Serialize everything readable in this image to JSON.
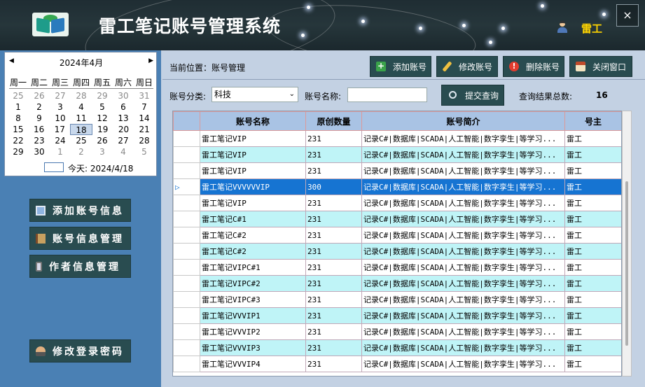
{
  "app": {
    "title": "雷工笔记账号管理系统",
    "user": "雷工",
    "close_icon_glyph": "×"
  },
  "calendar": {
    "month_label": "2024年4月",
    "prev_glyph": "◀",
    "next_glyph": "▶",
    "weekdays": [
      "周一",
      "周二",
      "周三",
      "周四",
      "周五",
      "周六",
      "周日"
    ],
    "weeks": [
      [
        "25",
        "26",
        "27",
        "28",
        "29",
        "30",
        "31"
      ],
      [
        "1",
        "2",
        "3",
        "4",
        "5",
        "6",
        "7"
      ],
      [
        "8",
        "9",
        "10",
        "11",
        "12",
        "13",
        "14"
      ],
      [
        "15",
        "16",
        "17",
        "18",
        "19",
        "20",
        "21"
      ],
      [
        "22",
        "23",
        "24",
        "25",
        "26",
        "27",
        "28"
      ],
      [
        "29",
        "30",
        "1",
        "2",
        "3",
        "4",
        "5"
      ]
    ],
    "selected_day": "18",
    "today_label": "今天: 2024/4/18"
  },
  "sidebar": {
    "items": [
      {
        "label": "添加账号信息",
        "icon": "monitor-icon"
      },
      {
        "label": "账号信息管理",
        "icon": "book-icon"
      },
      {
        "label": "作者信息管理",
        "icon": "phone-icon"
      },
      {
        "label": "修改登录密码",
        "icon": "user-lock-icon"
      }
    ]
  },
  "toolbar": {
    "breadcrumb": "当前位置：账号管理",
    "add_label": "添加账号",
    "edit_label": "修改账号",
    "delete_label": "删除账号",
    "close_label": "关闭窗口"
  },
  "filter": {
    "category_label": "账号分类:",
    "category_value": "科技",
    "name_label": "账号名称:",
    "name_value": "",
    "query_label": "提交查询",
    "total_label": "查询结果总数:",
    "total_value": "16"
  },
  "grid": {
    "columns": [
      "账号名称",
      "原创数量",
      "账号简介",
      "号主"
    ],
    "rows": [
      [
        "雷工笔记VIP",
        "231",
        "记录C#|数据库|SCADA|人工智能|数字孪生|等学习...",
        "雷工"
      ],
      [
        "雷工笔记VIP",
        "231",
        "记录C#|数据库|SCADA|人工智能|数字孪生|等学习...",
        "雷工"
      ],
      [
        "雷工笔记VIP",
        "231",
        "记录C#|数据库|SCADA|人工智能|数字孪生|等学习...",
        "雷工"
      ],
      [
        "雷工笔记VVVVVVIP",
        "300",
        "记录C#|数据库|SCADA|人工智能|数字孪生|等学习...",
        "雷工"
      ],
      [
        "雷工笔记VIP",
        "231",
        "记录C#|数据库|SCADA|人工智能|数字孪生|等学习...",
        "雷工"
      ],
      [
        "雷工笔记C#1",
        "231",
        "记录C#|数据库|SCADA|人工智能|数字孪生|等学习...",
        "雷工"
      ],
      [
        "雷工笔记C#2",
        "231",
        "记录C#|数据库|SCADA|人工智能|数字孪生|等学习...",
        "雷工"
      ],
      [
        "雷工笔记C#2",
        "231",
        "记录C#|数据库|SCADA|人工智能|数字孪生|等学习...",
        "雷工"
      ],
      [
        "雷工笔记VIPC#1",
        "231",
        "记录C#|数据库|SCADA|人工智能|数字孪生|等学习...",
        "雷工"
      ],
      [
        "雷工笔记VIPC#2",
        "231",
        "记录C#|数据库|SCADA|人工智能|数字孪生|等学习...",
        "雷工"
      ],
      [
        "雷工笔记VIPC#3",
        "231",
        "记录C#|数据库|SCADA|人工智能|数字孪生|等学习...",
        "雷工"
      ],
      [
        "雷工笔记VVVIP1",
        "231",
        "记录C#|数据库|SCADA|人工智能|数字孪生|等学习...",
        "雷工"
      ],
      [
        "雷工笔记VVVIP2",
        "231",
        "记录C#|数据库|SCADA|人工智能|数字孪生|等学习...",
        "雷工"
      ],
      [
        "雷工笔记VVVIP3",
        "231",
        "记录C#|数据库|SCADA|人工智能|数字孪生|等学习...",
        "雷工"
      ],
      [
        "雷工笔记VVVIP4",
        "231",
        "记录C#|数据库|SCADA|人工智能|数字孪生|等学习...",
        "雷工"
      ]
    ],
    "selected_row": 3,
    "row_indicator_glyph": "▷"
  },
  "colors": {
    "header_bg": "#1f2d33",
    "button_bg": "#294c50",
    "sidebar_bg": "#4a80b4",
    "row_alt": "#bff4f7",
    "row_selected": "#1674d2",
    "title_accent": "#ffd400"
  }
}
